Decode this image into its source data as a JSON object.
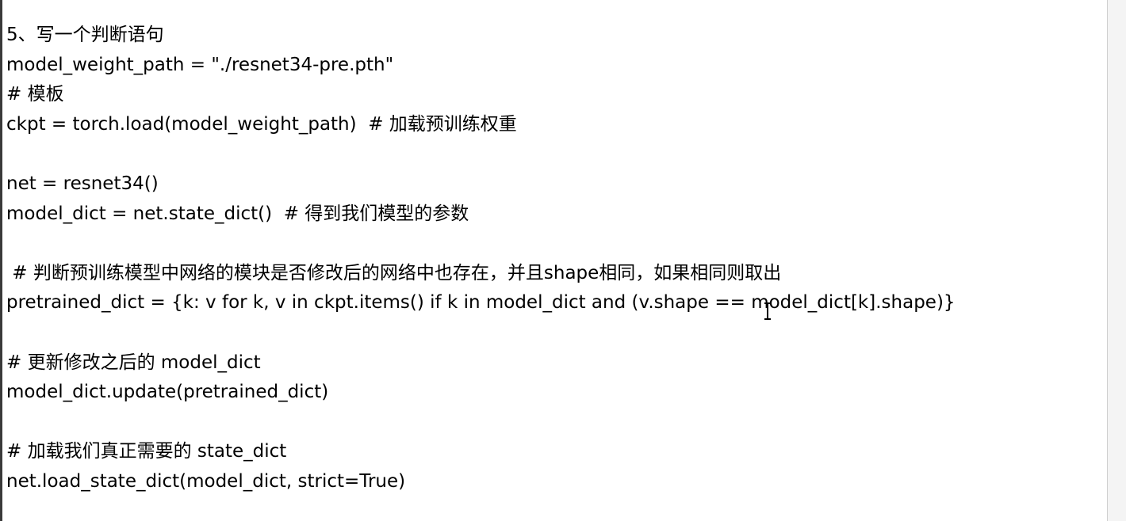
{
  "document": {
    "lines": [
      "5、写一个判断语句",
      "model_weight_path = \"./resnet34-pre.pth\"",
      "# 模板",
      "ckpt = torch.load(model_weight_path)  # 加载预训练权重",
      "",
      "net = resnet34()",
      "model_dict = net.state_dict()  # 得到我们模型的参数",
      "",
      " # 判断预训练模型中网络的模块是否修改后的网络中也存在，并且shape相同，如果相同则取出",
      "pretrained_dict = {k: v for k, v in ckpt.items() if k in model_dict and (v.shape == model_dict[k].shape)}",
      "",
      "# 更新修改之后的 model_dict",
      "model_dict.update(pretrained_dict)",
      "",
      "# 加载我们真正需要的 state_dict",
      "net.load_state_dict(model_dict, strict=True)"
    ]
  },
  "cursor_icon": "text-ibeam-cursor-icon",
  "colors": {
    "background": "#ffffff",
    "text": "#000000"
  }
}
